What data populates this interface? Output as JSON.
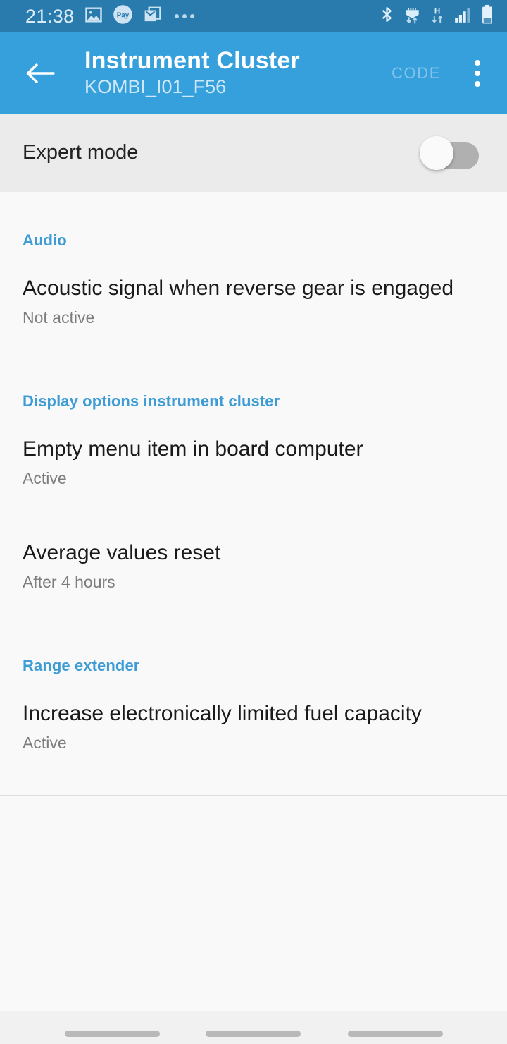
{
  "status_bar": {
    "time": "21:38",
    "left_icons": [
      "gallery-icon",
      "pay-icon",
      "email-icon",
      "more-notifications-icon"
    ],
    "right_icons": [
      "bluetooth-icon",
      "wifi-transfer-icon",
      "hspa-data-icon",
      "signal-bars-icon",
      "battery-icon"
    ],
    "pay_label": "Pay",
    "network_label": "H",
    "background": "#2a7bad"
  },
  "app_bar": {
    "back_label": "Back",
    "title": "Instrument Cluster",
    "subtitle": "KOMBI_I01_F56",
    "code_label": "CODE",
    "overflow_label": "More options",
    "background": "#36a0dd",
    "accent": "#3d9bd5"
  },
  "expert_mode": {
    "label": "Expert mode",
    "enabled": false,
    "state_text": "Off"
  },
  "sections": [
    {
      "header": "Audio",
      "items": [
        {
          "title": "Acoustic signal when reverse gear is engaged",
          "summary": "Not active",
          "divider_after": false
        }
      ]
    },
    {
      "header": "Display options instrument cluster",
      "items": [
        {
          "title": "Empty menu item in board computer",
          "summary": "Active",
          "divider_after": true
        },
        {
          "title": "Average values reset",
          "summary": "After 4 hours",
          "divider_after": false
        }
      ]
    },
    {
      "header": "Range extender",
      "items": [
        {
          "title": "Increase electronically limited fuel capacity",
          "summary": "Active",
          "divider_after": true
        }
      ]
    }
  ],
  "nav_bar": {
    "buttons": [
      "recents-button",
      "home-button",
      "back-button"
    ]
  }
}
